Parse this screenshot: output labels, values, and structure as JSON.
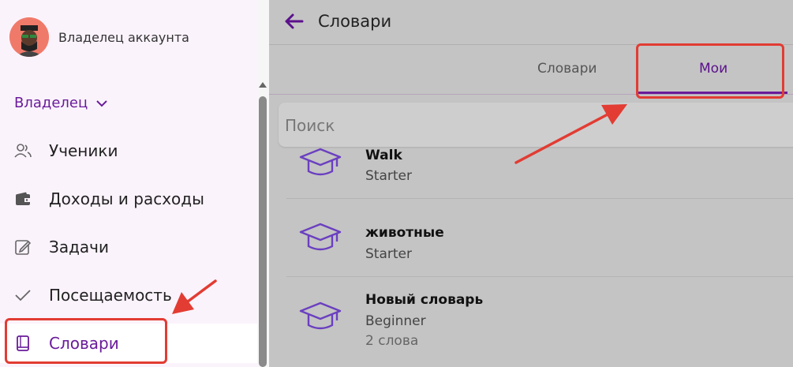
{
  "account": {
    "name": "Владелец аккаунта"
  },
  "sidebar": {
    "role": "Владелец",
    "items": [
      {
        "label": "Ученики",
        "icon": "users-icon"
      },
      {
        "label": "Доходы и расходы",
        "icon": "wallet-icon"
      },
      {
        "label": "Задачи",
        "icon": "edit-icon"
      },
      {
        "label": "Посещаемость",
        "icon": "check-icon"
      },
      {
        "label": "Словари",
        "icon": "book-icon",
        "active": true
      }
    ]
  },
  "header": {
    "title": "Словари"
  },
  "tabs": [
    {
      "label": "Словари"
    },
    {
      "label": "Мои",
      "active": true
    }
  ],
  "search": {
    "placeholder": "Поиск"
  },
  "dictionaries": [
    {
      "name": "Walk",
      "level": "Starter",
      "count": ""
    },
    {
      "name": "животные",
      "level": "Starter",
      "count": ""
    },
    {
      "name": "Новый словарь",
      "level": "Beginner",
      "count": "2 слова"
    }
  ],
  "colors": {
    "accent": "#6a1b9a",
    "annotation": "#e23c33",
    "sidebar_bg": "#fbf3fc",
    "main_overlay": "#c4c4c4"
  }
}
